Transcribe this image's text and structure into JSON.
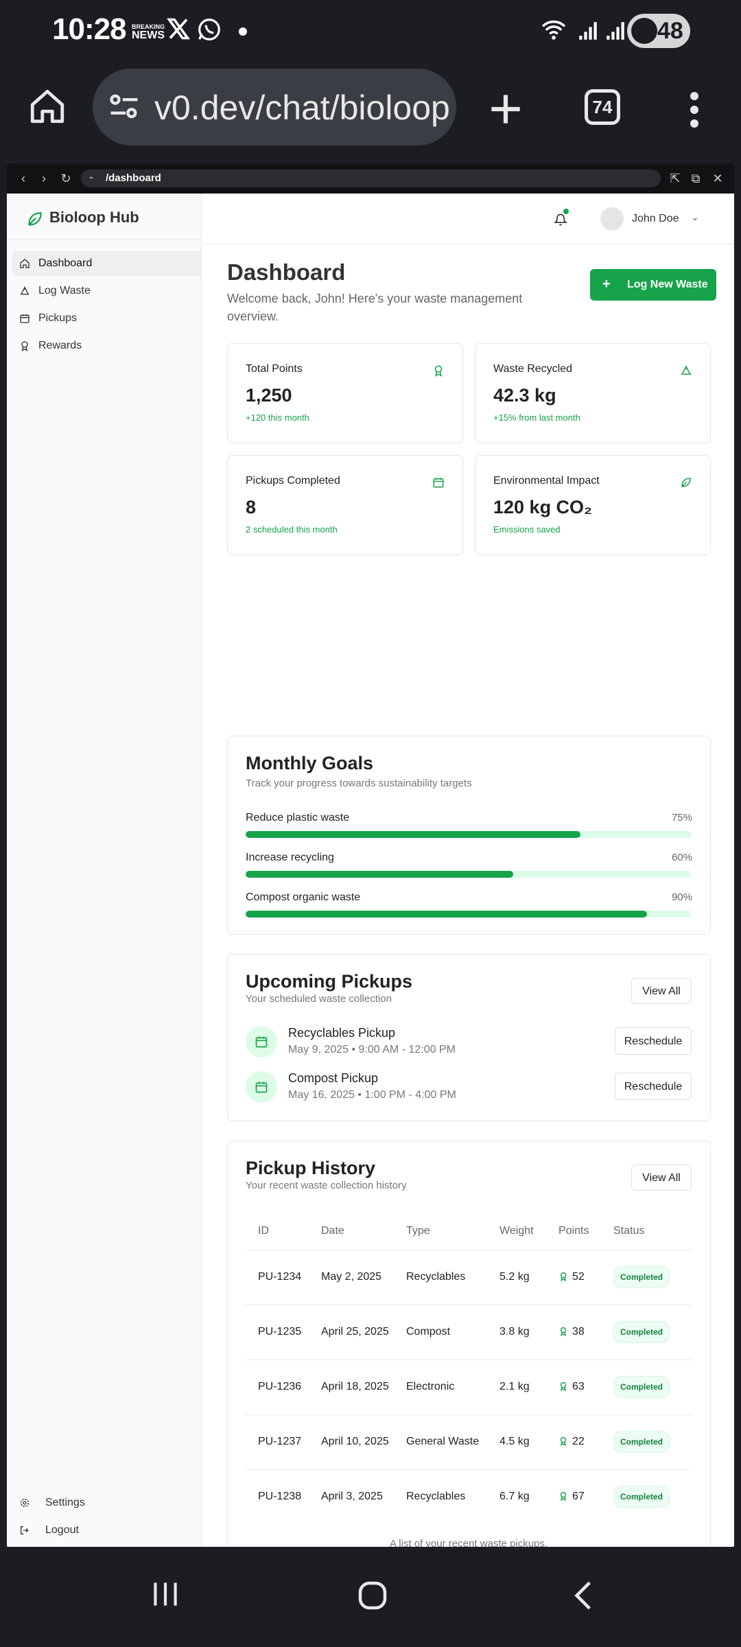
{
  "status_bar": {
    "time": "10:28",
    "news_top": "BREAKING",
    "news_bottom": "NEWS",
    "battery": "48"
  },
  "browser": {
    "url": "v0.dev/chat/bioloop-",
    "tab_count": "74"
  },
  "preview": {
    "path": "/dashboard"
  },
  "sidebar": {
    "brand": "Bioloop Hub",
    "items": [
      {
        "label": "Dashboard",
        "icon": "home-icon"
      },
      {
        "label": "Log Waste",
        "icon": "recycle-icon"
      },
      {
        "label": "Pickups",
        "icon": "calendar-icon"
      },
      {
        "label": "Rewards",
        "icon": "award-icon"
      }
    ],
    "footer": [
      {
        "label": "Settings",
        "icon": "gear-icon"
      },
      {
        "label": "Logout",
        "icon": "logout-icon"
      }
    ]
  },
  "header": {
    "user_name": "John Doe"
  },
  "page": {
    "title": "Dashboard",
    "subtitle": "Welcome back, John! Here's your waste management overview.",
    "primary_button": "Log New Waste"
  },
  "stats": [
    {
      "label": "Total Points",
      "value": "1,250",
      "note": "+120 this month",
      "icon": "award-icon"
    },
    {
      "label": "Waste Recycled",
      "value": "42.3 kg",
      "note": "+15% from last month",
      "icon": "recycle-icon"
    },
    {
      "label": "Pickups Completed",
      "value": "8",
      "note": "2 scheduled this month",
      "icon": "calendar-icon"
    },
    {
      "label": "Environmental Impact",
      "value": "120 kg CO₂",
      "note": "Emissions saved",
      "icon": "leaf-icon"
    }
  ],
  "goals": {
    "title": "Monthly Goals",
    "subtitle": "Track your progress towards sustainability targets",
    "items": [
      {
        "label": "Reduce plastic waste",
        "percent_text": "75%",
        "progress": 0.75
      },
      {
        "label": "Increase recycling",
        "percent_text": "60%",
        "progress": 0.6
      },
      {
        "label": "Compost organic waste",
        "percent_text": "90%",
        "progress": 0.9
      }
    ]
  },
  "upcoming": {
    "title": "Upcoming Pickups",
    "subtitle": "Your scheduled waste collection",
    "view_all": "View All",
    "items": [
      {
        "title": "Recyclables Pickup",
        "when": "May 9, 2025 • 9:00 AM - 12:00 PM",
        "action": "Reschedule"
      },
      {
        "title": "Compost Pickup",
        "when": "May 16, 2025 • 1:00 PM - 4:00 PM",
        "action": "Reschedule"
      }
    ]
  },
  "history": {
    "title": "Pickup History",
    "subtitle": "Your recent waste collection history",
    "view_all": "View All",
    "columns": [
      "ID",
      "Date",
      "Type",
      "Weight",
      "Points",
      "Status"
    ],
    "rows": [
      {
        "id": "PU-1234",
        "date": "May 2, 2025",
        "type": "Recyclables",
        "weight": "5.2 kg",
        "points": "52",
        "status": "Completed"
      },
      {
        "id": "PU-1235",
        "date": "April 25, 2025",
        "type": "Compost",
        "weight": "3.8 kg",
        "points": "38",
        "status": "Completed"
      },
      {
        "id": "PU-1236",
        "date": "April 18, 2025",
        "type": "Electronic",
        "weight": "2.1 kg",
        "points": "63",
        "status": "Completed"
      },
      {
        "id": "PU-1237",
        "date": "April 10, 2025",
        "type": "General Waste",
        "weight": "4.5 kg",
        "points": "22",
        "status": "Completed"
      },
      {
        "id": "PU-1238",
        "date": "April 3, 2025",
        "type": "Recyclables",
        "weight": "6.7 kg",
        "points": "67",
        "status": "Completed"
      }
    ],
    "caption": "A list of your recent waste pickups."
  },
  "colors": {
    "accent": "#16a34a",
    "accent_light": "#dcfce7",
    "frame_dark": "#1b1d23"
  }
}
